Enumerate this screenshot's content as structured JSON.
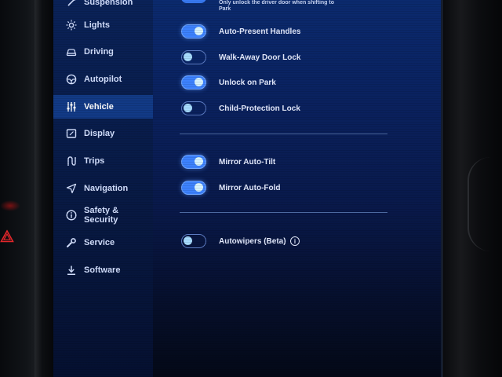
{
  "sidebar": {
    "items": [
      {
        "label": "Suspension",
        "icon": "suspension-icon"
      },
      {
        "label": "Lights",
        "icon": "sun-icon"
      },
      {
        "label": "Driving",
        "icon": "car-icon"
      },
      {
        "label": "Autopilot",
        "icon": "steering-wheel-icon"
      },
      {
        "label": "Vehicle",
        "icon": "sliders-icon",
        "active": true
      },
      {
        "label": "Display",
        "icon": "display-icon"
      },
      {
        "label": "Trips",
        "icon": "route-icon"
      },
      {
        "label": "Navigation",
        "icon": "navigation-arrow-icon"
      },
      {
        "label": "Safety & Security",
        "line1": "Safety &",
        "line2": "Security",
        "icon": "info-circle-icon"
      },
      {
        "label": "Service",
        "icon": "wrench-icon"
      },
      {
        "label": "Software",
        "icon": "download-icon"
      }
    ]
  },
  "settings": {
    "top_note": "Only unlock the driver door when shifting to Park",
    "auto_present": {
      "label": "Auto-Present Handles",
      "on": true
    },
    "walk_away": {
      "label": "Walk-Away Door Lock",
      "on": false
    },
    "unlock_park": {
      "label": "Unlock on Park",
      "on": true
    },
    "child_lock": {
      "label": "Child-Protection Lock",
      "on": false
    },
    "mirror_tilt": {
      "label": "Mirror Auto-Tilt",
      "on": true
    },
    "mirror_fold": {
      "label": "Mirror Auto-Fold",
      "on": true
    },
    "autowipers": {
      "label": "Autowipers (Beta)",
      "on": false,
      "info_glyph": "i"
    }
  },
  "colors": {
    "toggle_on": "#3d82ff",
    "active_nav": "#123a86",
    "screen_bg": "#0a2260"
  }
}
